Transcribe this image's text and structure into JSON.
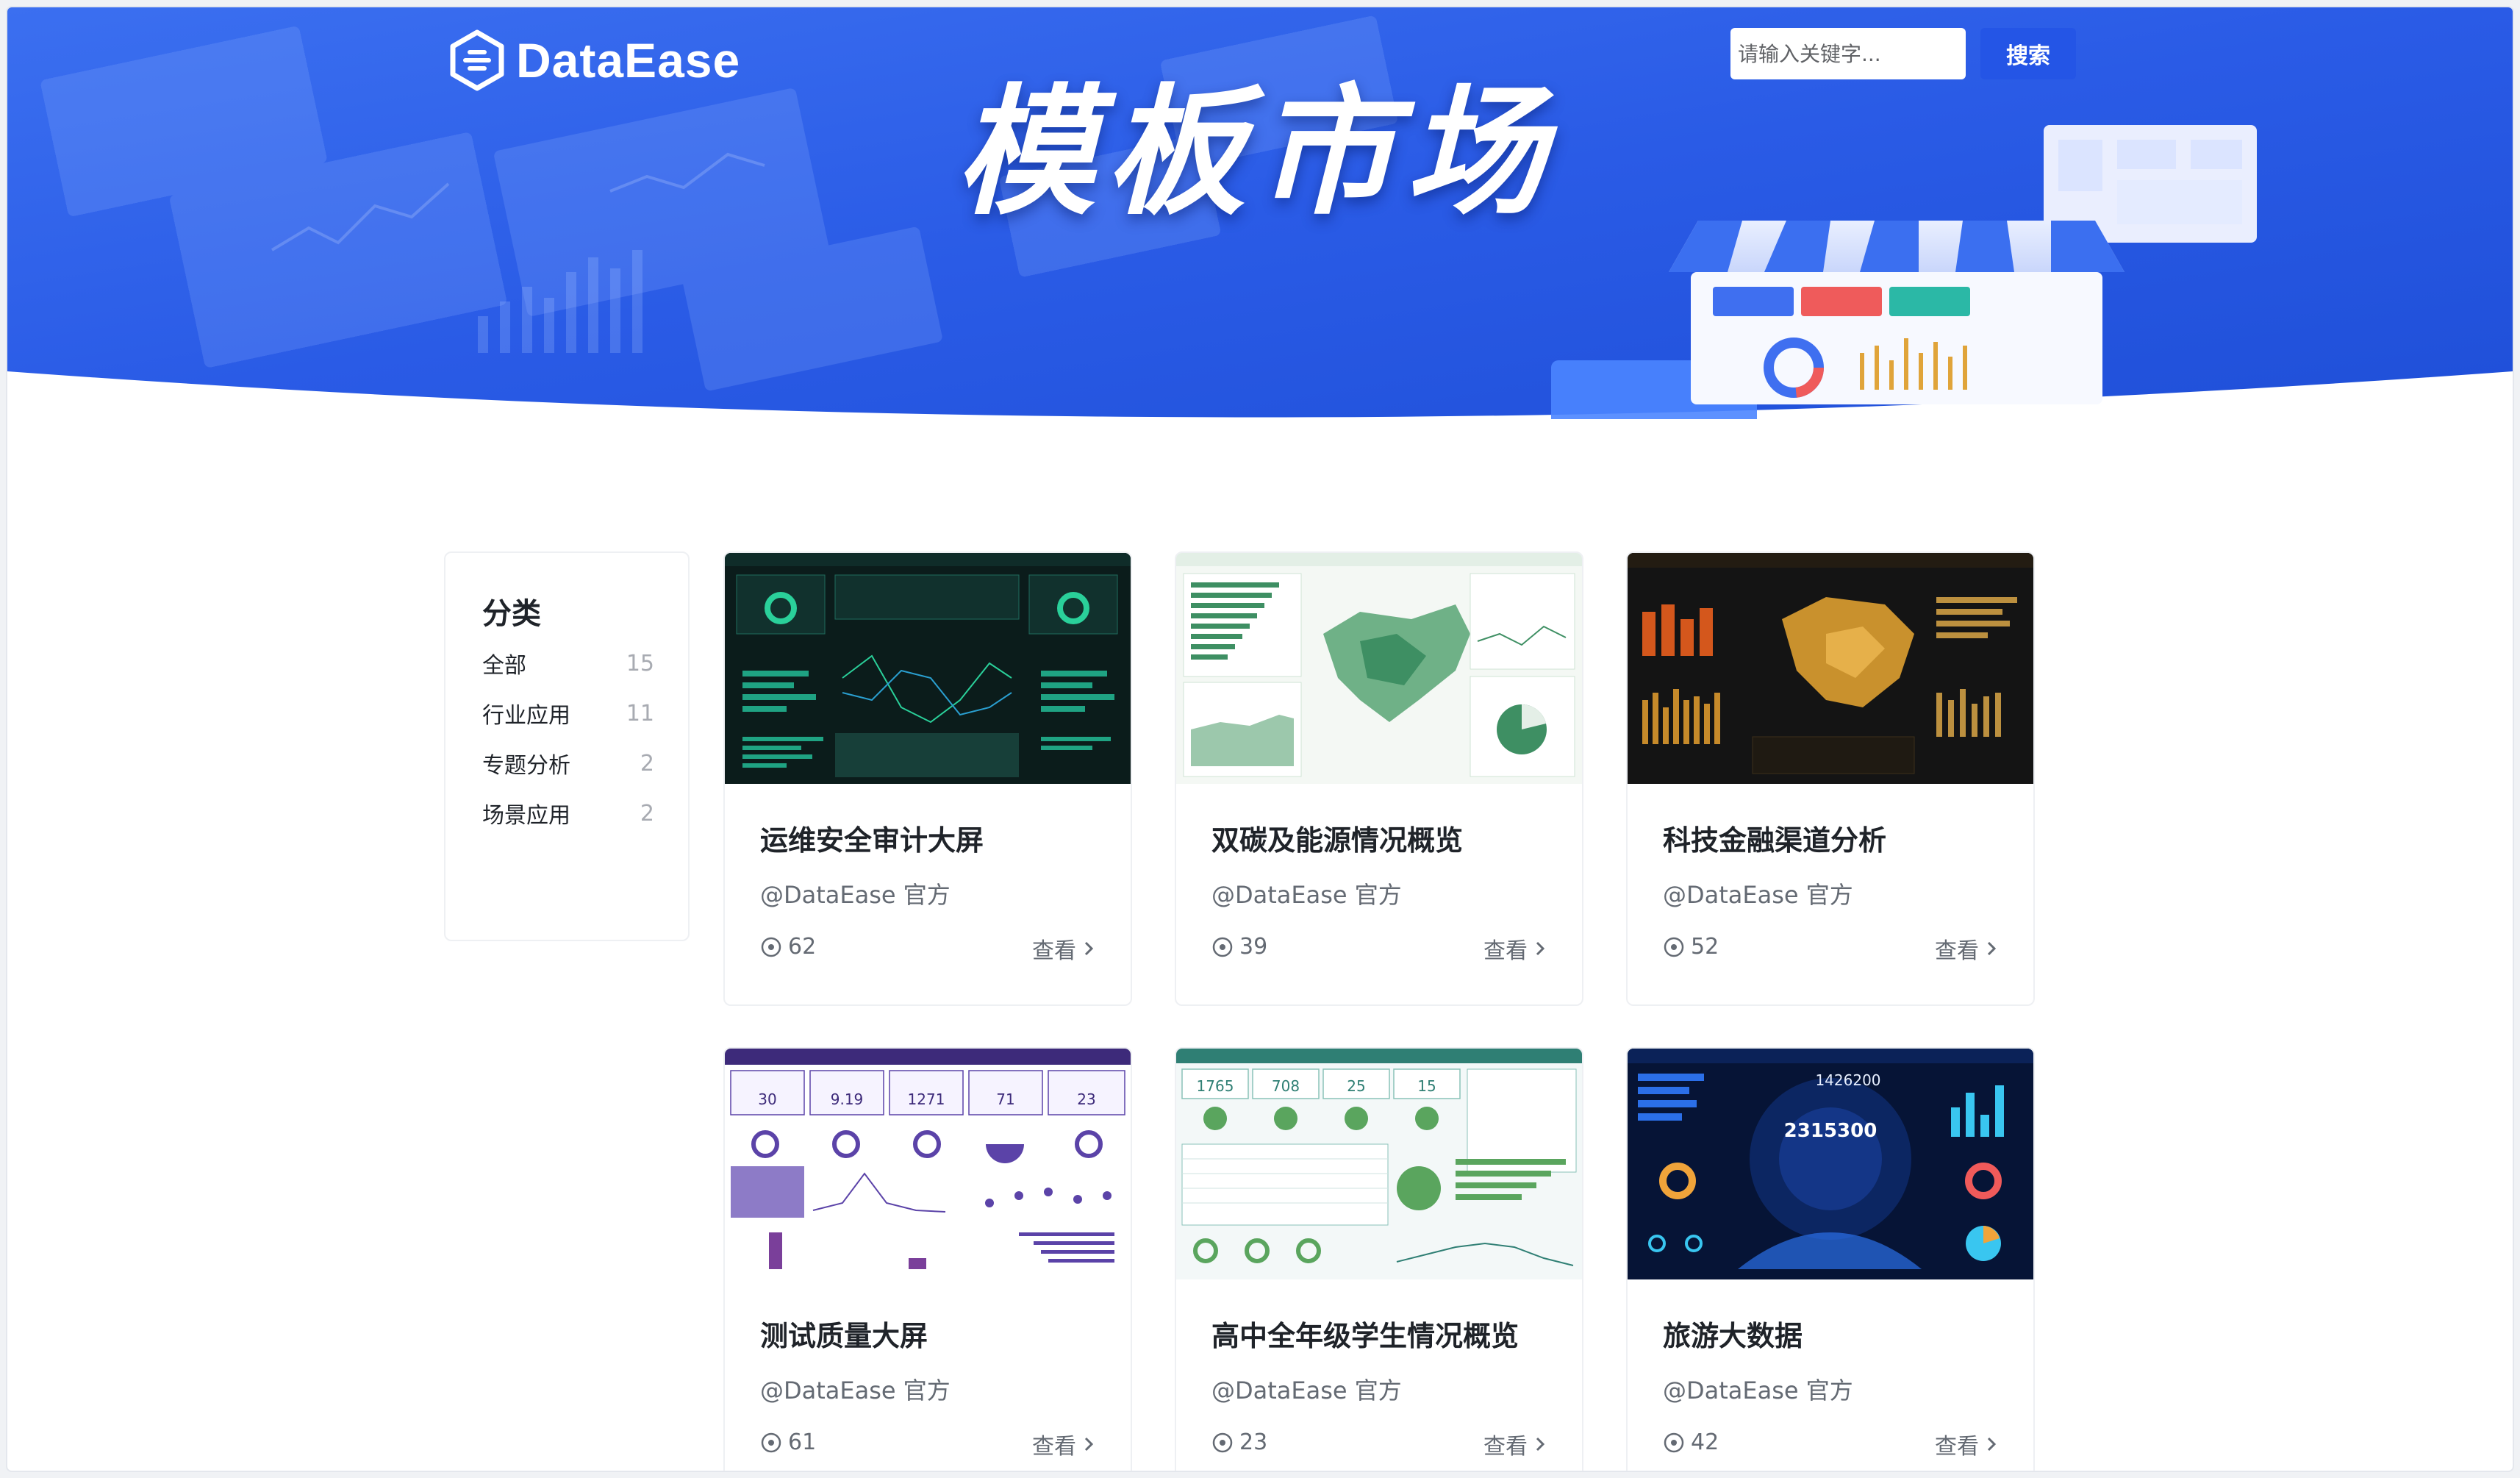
{
  "brand": {
    "name": "DataEase"
  },
  "hero": {
    "title": "模板市场"
  },
  "search": {
    "placeholder": "请输入关键字...",
    "button_label": "搜索"
  },
  "sidebar": {
    "title": "分类",
    "categories": [
      {
        "label": "全部",
        "count": "15"
      },
      {
        "label": "行业应用",
        "count": "11"
      },
      {
        "label": "专题分析",
        "count": "2"
      },
      {
        "label": "场景应用",
        "count": "2"
      }
    ]
  },
  "templates": [
    {
      "title": "运维安全审计大屏",
      "author": "@DataEase 官方",
      "views": "62",
      "action": "查看",
      "theme": "dark-green"
    },
    {
      "title": "双碳及能源情况概览",
      "author": "@DataEase 官方",
      "views": "39",
      "action": "查看",
      "theme": "light-green"
    },
    {
      "title": "科技金融渠道分析",
      "author": "@DataEase 官方",
      "views": "52",
      "action": "查看",
      "theme": "dark-gold"
    },
    {
      "title": "测试质量大屏",
      "author": "@DataEase 官方",
      "views": "61",
      "action": "查看",
      "theme": "light-purple"
    },
    {
      "title": "高中全年级学生情况概览",
      "author": "@DataEase 官方",
      "views": "23",
      "action": "查看",
      "theme": "light-teal"
    },
    {
      "title": "旅游大数据",
      "author": "@DataEase 官方",
      "views": "42",
      "action": "查看",
      "theme": "dark-blue"
    }
  ],
  "thumbnail_numbers": {
    "test_quality": [
      "30",
      "9.19",
      "1271",
      "71",
      "23"
    ],
    "students": [
      "1765",
      "708",
      "25",
      "15"
    ],
    "tourism": [
      "1426200",
      "2315300"
    ]
  },
  "colors": {
    "brand_blue": "#2455e6",
    "hero_blue": "#2b5de8",
    "text_primary": "#1f2329",
    "text_secondary": "#646a73",
    "text_muted": "#a8abb2"
  }
}
